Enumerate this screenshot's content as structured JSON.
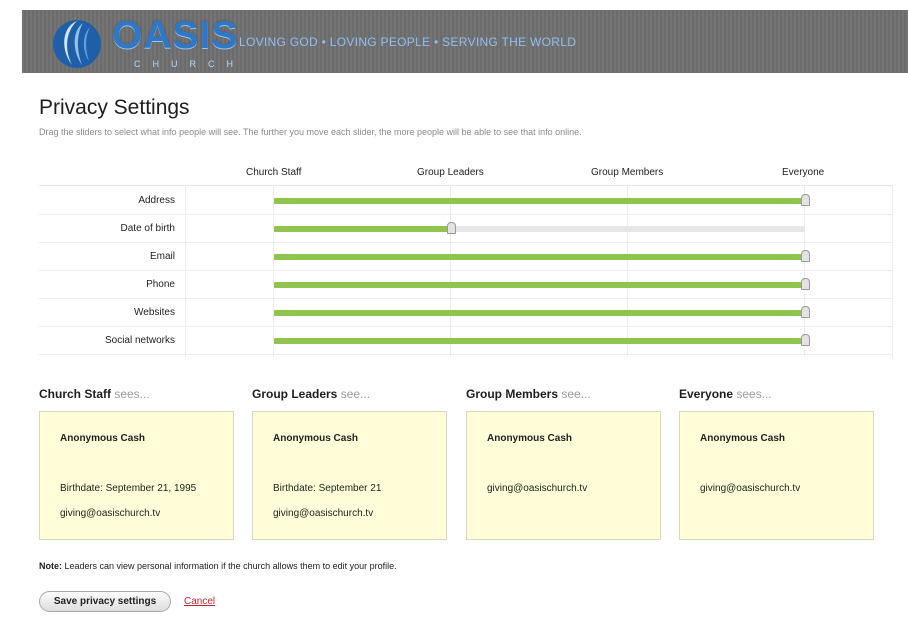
{
  "header": {
    "logo_word": "OASIS",
    "logo_sub": "CHURCH",
    "tagline": "LOVING GOD • LOVING PEOPLE • SERVING THE WORLD",
    "bg_color": "#6f6f6f",
    "logo_color": "#2f78c8"
  },
  "page": {
    "title": "Privacy Settings",
    "description": "Drag the sliders to select what info people will see. The further you move each slider, the more people will be able to see that info online."
  },
  "columns": [
    "Church Staff",
    "Group Leaders",
    "Group Members",
    "Everyone"
  ],
  "sliders": [
    {
      "label": "Address",
      "level": 1.0
    },
    {
      "label": "Date of birth",
      "level": 0.333
    },
    {
      "label": "Email",
      "level": 1.0
    },
    {
      "label": "Phone",
      "level": 1.0
    },
    {
      "label": "Websites",
      "level": 1.0
    },
    {
      "label": "Social networks",
      "level": 1.0
    }
  ],
  "slider_fill_color": "#8fc44e",
  "previews": [
    {
      "audience": "Church Staff",
      "verb": " sees...",
      "name": "Anonymous Cash",
      "lines": [
        "Birthdate: September 21, 1995",
        "giving@oasischurch.tv"
      ]
    },
    {
      "audience": "Group Leaders",
      "verb": " see...",
      "name": "Anonymous Cash",
      "lines": [
        "Birthdate: September 21",
        "giving@oasischurch.tv"
      ]
    },
    {
      "audience": "Group Members",
      "verb": " see...",
      "name": "Anonymous Cash",
      "lines": [
        "giving@oasischurch.tv"
      ]
    },
    {
      "audience": "Everyone",
      "verb": " sees...",
      "name": "Anonymous Cash",
      "lines": [
        "giving@oasischurch.tv"
      ]
    }
  ],
  "card_color": "#fffed9",
  "note": {
    "label": "Note:",
    "text": " Leaders can view personal information if the church allows them to edit your profile."
  },
  "actions": {
    "save_label": "Save privacy settings",
    "cancel_label": "Cancel"
  }
}
